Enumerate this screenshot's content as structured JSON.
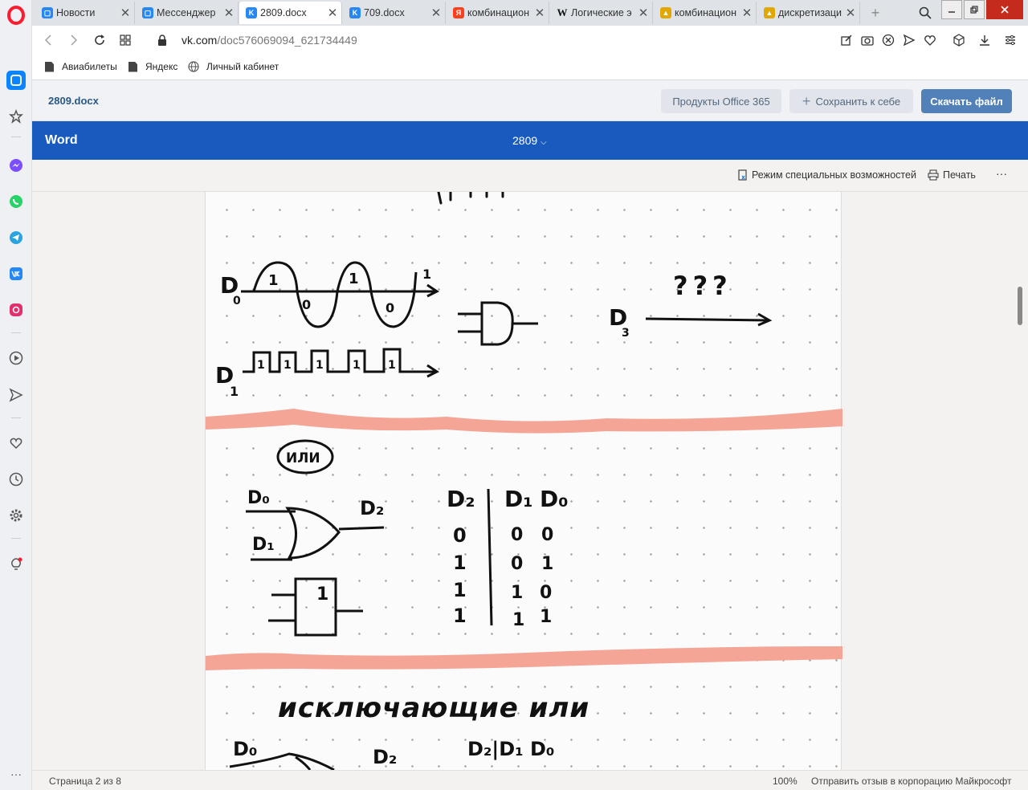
{
  "browser": {
    "tabs": [
      {
        "label": "Новости",
        "favicon": "vk-message-icon",
        "color": "#2787f5"
      },
      {
        "label": "Мессенджер",
        "favicon": "vk-message-icon",
        "color": "#2787f5"
      },
      {
        "label": "2809.docx",
        "favicon": "vk-icon",
        "color": "#2787f5"
      },
      {
        "label": "709.docx",
        "favicon": "vk-icon",
        "color": "#2787f5"
      },
      {
        "label": "комбинацион",
        "favicon": "yandex-icon",
        "color": "#fc3f1d"
      },
      {
        "label": "Логические э",
        "favicon": "wikipedia-icon",
        "color": "#ffffff"
      },
      {
        "label": "комбинацион",
        "favicon": "image-icon",
        "color": "#e0a800"
      },
      {
        "label": "дискретизаци",
        "favicon": "image-icon",
        "color": "#e0a800"
      }
    ],
    "url_host": "vk.com",
    "url_path": "/doc576069094_621734449",
    "bookmarks": [
      "Авиабилеты",
      "Яндекс",
      "Личный кабинет"
    ]
  },
  "vk": {
    "doc_title": "2809.docx",
    "office_button": "Продукты Office 365",
    "save_button": "Сохранить к себе",
    "download_button": "Скачать файл"
  },
  "word": {
    "app_name": "Word",
    "doc_name": "2809",
    "accessibility": "Режим специальных возможностей",
    "print": "Печать",
    "more": "···"
  },
  "status": {
    "page": "Страница 2 из 8",
    "zoom": "100%",
    "feedback": "Отправить отзыв в корпорацию Майкрософт"
  },
  "handwriting": {
    "d0": "D",
    "d0_sub": "0",
    "d1": "D",
    "d1_sub": "1",
    "d3": "D",
    "d3_sub": "3",
    "wave_one_a": "1",
    "wave_zero_a": "0",
    "wave_one_b": "1",
    "wave_zero_b": "0",
    "wave_end": "1",
    "question": "???",
    "pulse_digit": "1",
    "or_label": "ИЛИ",
    "or_d0": "D₀",
    "or_d1": "D₁",
    "or_d2": "D₂",
    "box_one": "1",
    "table_headers": [
      "D₂",
      "D₁",
      "D₀"
    ],
    "table_rows": [
      [
        "0",
        "0",
        "0"
      ],
      [
        "1",
        "0",
        "1"
      ],
      [
        "1",
        "1",
        "0"
      ],
      [
        "1",
        "1",
        "1"
      ]
    ],
    "xor_title": "исключающие или",
    "xor_d0": "D₀",
    "xor_d2": "D₂",
    "xor_headers": "D₂|D₁ D₀"
  },
  "colors": {
    "word_blue": "#185abd",
    "vk_blue": "#5181b8",
    "highlight": "#f4a596"
  }
}
